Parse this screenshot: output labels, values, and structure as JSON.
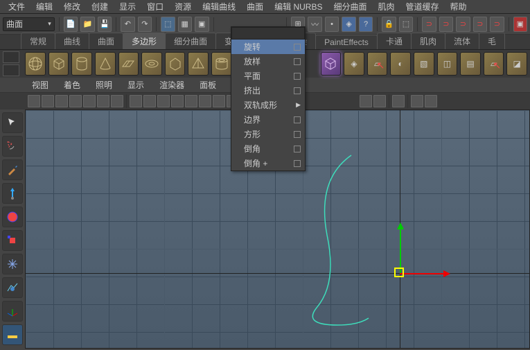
{
  "menubar": [
    "文件",
    "编辑",
    "修改",
    "创建",
    "显示",
    "窗口",
    "资源",
    "编辑曲线",
    "曲面",
    "编辑 NURBS",
    "细分曲面",
    "肌肉",
    "管道缓存",
    "帮助"
  ],
  "combo_label": "曲面",
  "tabs": [
    "常规",
    "曲线",
    "曲面",
    "多边形",
    "细分曲面",
    "变",
    "",
    "",
    "渲染",
    "PaintEffects",
    "卡通",
    "肌肉",
    "流体",
    "毛"
  ],
  "active_tab_index": 3,
  "viewtabs": [
    "视图",
    "着色",
    "照明",
    "显示",
    "渲染器",
    "面板"
  ],
  "dropdown": {
    "items": [
      {
        "label": "旋转",
        "highlight": true,
        "box": true
      },
      {
        "label": "放样",
        "box": true
      },
      {
        "label": "平面",
        "box": true
      },
      {
        "label": "挤出",
        "box": true
      },
      {
        "label": "双轨成形",
        "arrow": true
      },
      {
        "label": "边界",
        "box": true
      },
      {
        "label": "方形",
        "box": true
      },
      {
        "label": "倒角",
        "box": true
      },
      {
        "label": "倒角 +",
        "box": true
      }
    ]
  }
}
